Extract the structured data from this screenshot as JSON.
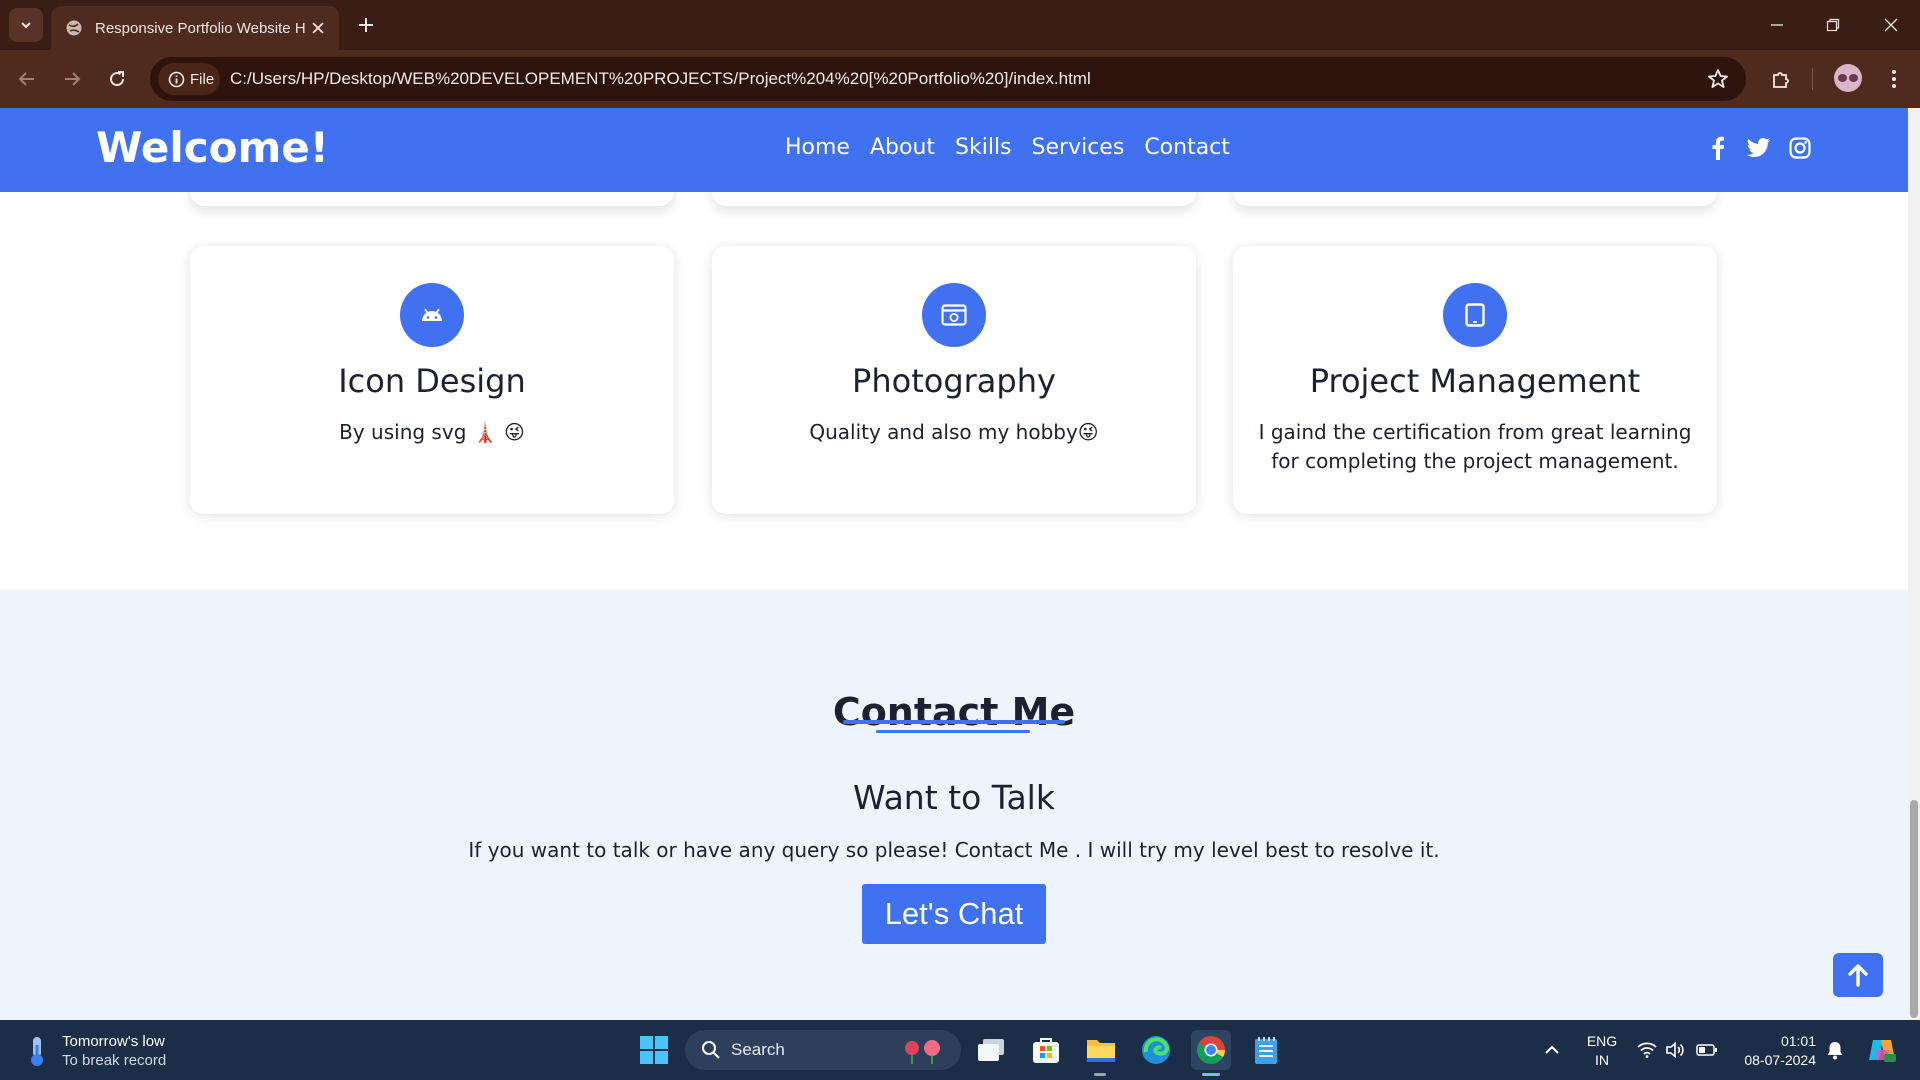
{
  "browser": {
    "tab_title": "Responsive Portfolio Website H",
    "site_chip": "File",
    "url": "C:/Users/HP/Desktop/WEB%20DEVELOPEMENT%20PROJECTS/Project%204%20[%20Portfolio%20]/index.html"
  },
  "navbar": {
    "brand": "Welcome!",
    "links": [
      "Home",
      "About",
      "Skills",
      "Services",
      "Contact"
    ],
    "socials": [
      "facebook-icon",
      "twitter-icon",
      "instagram-icon"
    ]
  },
  "services": [
    {
      "icon": "android-icon",
      "title": "Icon Design",
      "desc": "By using svg 🗼 😜"
    },
    {
      "icon": "browser-window-icon",
      "title": "Photography",
      "desc": "Quality and also my hobby😜"
    },
    {
      "icon": "tablet-icon",
      "title": "Project Management",
      "desc": "I gaind the certification from great learning for completing the project management."
    }
  ],
  "contact": {
    "heading": "Contact Me",
    "subheading": "Want to Talk",
    "text": "If you want to talk or have any query so please! Contact Me . I will try my level best to resolve it.",
    "button": "Let's Chat"
  },
  "taskbar": {
    "weather_line1": "Tomorrow's low",
    "weather_line2": "To break record",
    "search_placeholder": "Search",
    "lang_line1": "ENG",
    "lang_line2": "IN",
    "time": "01:01",
    "date": "08-07-2024"
  },
  "colors": {
    "accent": "#3f71f0",
    "chrome_dark": "#3a1d15",
    "contact_bg": "#eef4fc",
    "taskbar": "#1c2d47"
  }
}
